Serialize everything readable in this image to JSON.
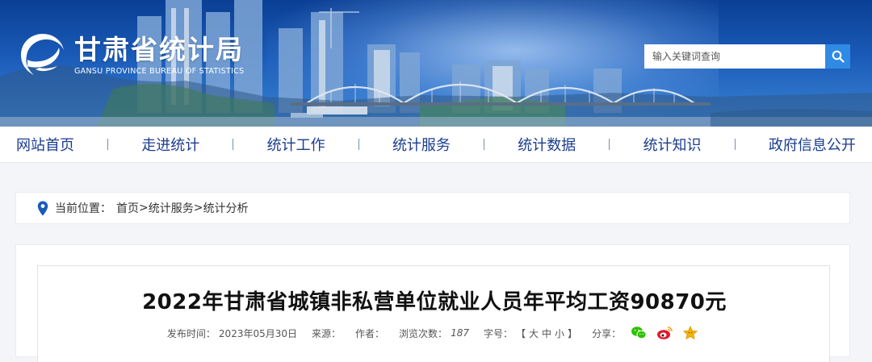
{
  "header": {
    "logo_cn": "甘肃省统计局",
    "logo_en": "GANSU PROVINCE BUREAU OF STATISTICS",
    "search": {
      "placeholder": "输入关键词查询"
    }
  },
  "nav": {
    "items": [
      {
        "label": "网站首页"
      },
      {
        "label": "走进统计"
      },
      {
        "label": "统计工作"
      },
      {
        "label": "统计服务"
      },
      {
        "label": "统计数据"
      },
      {
        "label": "统计知识"
      },
      {
        "label": "政府信息公开"
      }
    ]
  },
  "breadcrumb": {
    "label": "当前位置：",
    "items": [
      "首页",
      "统计服务",
      "统计分析"
    ],
    "separator": ">"
  },
  "article": {
    "title": "2022年甘肃省城镇非私营单位就业人员年平均工资90870元",
    "meta": {
      "publish_label": "发布时间：",
      "publish_date": "2023年05月30日",
      "source_label": "来源：",
      "author_label": "作者：",
      "views_label": "浏览次数：",
      "views": "187",
      "font_label": "字号：",
      "font_open": "【",
      "font_large": "大",
      "font_medium": "中",
      "font_small": "小",
      "font_close": "】",
      "share_label": "分享："
    },
    "share_icons": [
      "wechat-icon",
      "weibo-icon",
      "favorite-star-icon"
    ]
  },
  "colors": {
    "nav_text": "#1a3d8f",
    "search_button": "#2f8ae5",
    "banner_top": "#0a3f94",
    "wechat": "#2dc100",
    "weibo": "#e6162d",
    "star": "#f5b400"
  }
}
